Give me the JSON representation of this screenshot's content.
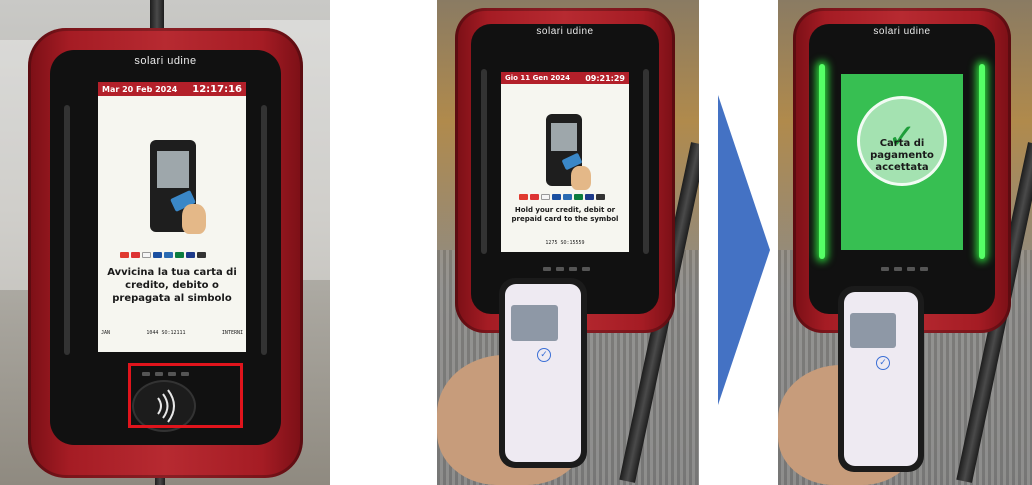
{
  "panels": [
    {
      "brand": "solari udine",
      "screen": {
        "date": "Mar 20 Feb 2024",
        "time": "12:17:16",
        "message": "Avvicina la tua carta di credito, debito o prepagata al simbolo",
        "footer_left": "JAN",
        "footer_code": "1044 SO:12111",
        "footer_right": "INTERNI"
      },
      "highlight": "nfc-reader"
    },
    {
      "brand": "solari udine",
      "screen": {
        "date": "Gio 11 Gen 2024",
        "time": "09:21:29",
        "message": "Hold your credit, debit or prepaid card to the symbol",
        "footer_code": "1275 SO:15559"
      }
    },
    {
      "brand": "solari udine",
      "screen": {
        "message": "Carta di pagamento accettata"
      }
    }
  ],
  "colors": {
    "device_red": "#b72a31",
    "screen_header": "#b3202a",
    "accepted_green": "#37bf52",
    "highlight_red": "#e0141c",
    "arrow_blue": "#4472c4"
  },
  "icons": [
    "phone-card-tap-illustration",
    "payment-cards-logos",
    "contactless-icon",
    "checkmark-icon",
    "arrow-right-icon"
  ]
}
